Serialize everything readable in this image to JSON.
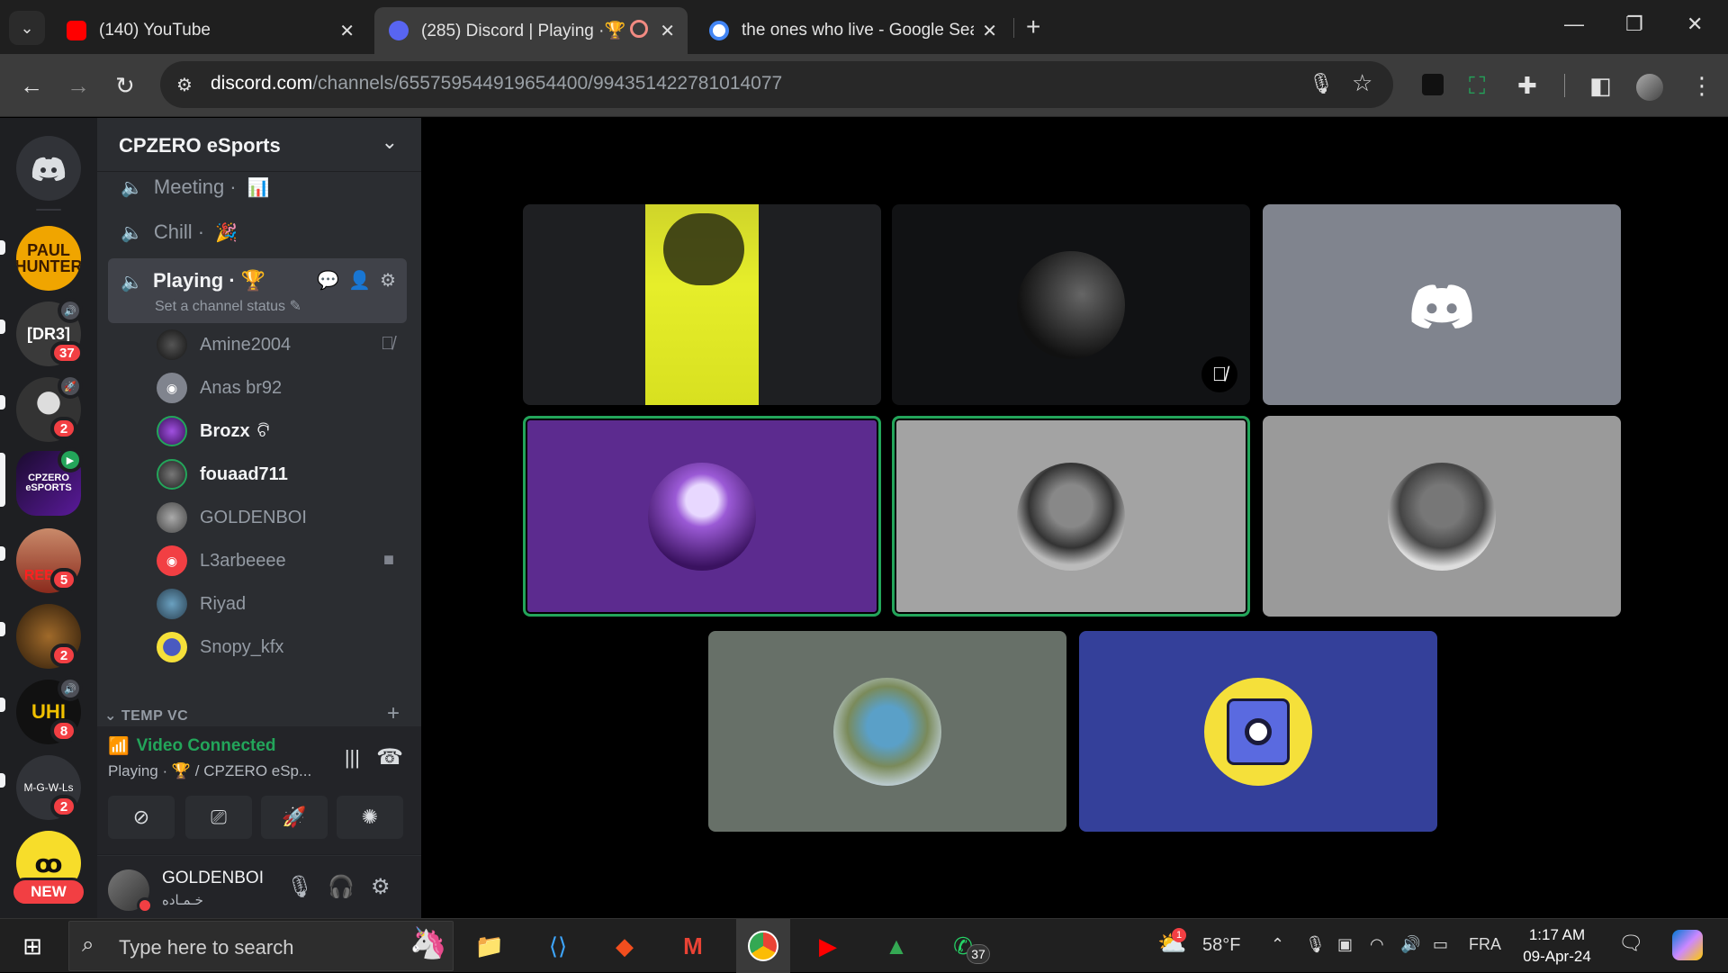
{
  "browser": {
    "tabs": [
      {
        "title": "(140) YouTube",
        "favicon": "youtube-icon"
      },
      {
        "title": "(285) Discord | Playing ·🏆",
        "favicon": "discord-icon",
        "badge": "285",
        "active": true
      },
      {
        "title": "the ones who live - Google Sear",
        "favicon": "google-icon"
      }
    ],
    "url_host": "discord.com",
    "url_path": "/channels/655759544919654400/994351422781014077"
  },
  "rail": {
    "servers": [
      {
        "label": "PAUL HUNTER",
        "color": "#f0a500"
      },
      {
        "label": "[DR3]",
        "color": "#3a3a3a",
        "badge": "37"
      },
      {
        "label": "",
        "color": "#555555",
        "badge": "2"
      },
      {
        "label": "CPZERO eSPORTS",
        "color": "#1a0b2e"
      },
      {
        "label": "REBEL",
        "color": "#8a2a1c",
        "badge": "5"
      },
      {
        "label": "",
        "color": "#4a3a22",
        "badge": "2"
      },
      {
        "label": "UHI",
        "color": "#c99700",
        "badge": "8"
      },
      {
        "label": "M-G-W-Ls",
        "color": "#2b2d31",
        "badge": "2"
      }
    ],
    "new_label": "NEW"
  },
  "sidebar": {
    "server_name": "CPZERO eSports",
    "channels": [
      {
        "name": "Meeting",
        "emoji": "📊"
      },
      {
        "name": "Chill",
        "emoji": "🎉"
      }
    ],
    "active_channel": {
      "name": "Playing",
      "emoji": "🏆",
      "status": "Set a channel status"
    },
    "members": [
      {
        "name": "Amine2004",
        "bold": false,
        "right": "mute-icon"
      },
      {
        "name": "Anas br92",
        "bold": false
      },
      {
        "name": "Brozx",
        "bold": true,
        "suffix": "ଟି"
      },
      {
        "name": "fouaad711",
        "bold": true
      },
      {
        "name": "GOLDENBOI",
        "bold": false
      },
      {
        "name": "L3arbeeee",
        "bold": false,
        "right": "video-icon"
      },
      {
        "name": "Riyad",
        "bold": false
      },
      {
        "name": "Snopy_kfx",
        "bold": false
      }
    ],
    "category": "TEMP VC",
    "voice": {
      "status": "Video Connected",
      "sub": "Playing · 🏆 / CPZERO eSp..."
    },
    "user": {
      "name": "GOLDENBOI",
      "sub": "خـمـاده"
    }
  },
  "taskbar": {
    "search_placeholder": "Type here to search",
    "temperature": "58°F",
    "language": "FRA",
    "time": "1:17 AM",
    "date": "09-Apr-24",
    "whatsapp_badge": "37",
    "weather_badge": "1"
  },
  "colors": {
    "accent": "#5865f2",
    "online": "#23a55a",
    "danger": "#f23f43"
  }
}
